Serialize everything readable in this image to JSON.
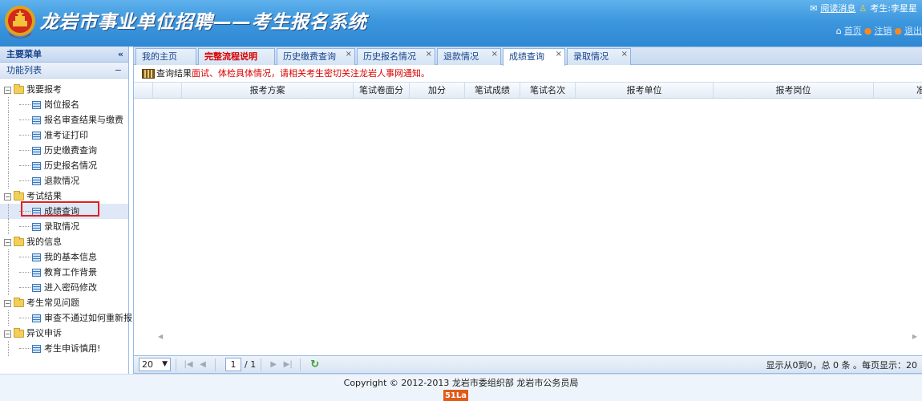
{
  "header": {
    "title": "龙岩市事业单位招聘——考生报名系统",
    "read_msg": "阅读消息",
    "user_label": "考生:李星星",
    "nav_home": "首页",
    "nav_cancel": "注销",
    "nav_exit": "退出"
  },
  "sidebar": {
    "main_menu": "主要菜单",
    "collapse": "«",
    "func_list": "功能列表",
    "minus": "−",
    "groups": [
      {
        "label": "我要报考",
        "items": [
          "岗位报名",
          "报名审查结果与缴费",
          "准考证打印",
          "历史缴费查询",
          "历史报名情况",
          "退款情况"
        ]
      },
      {
        "label": "考试结果",
        "items": [
          "成绩查询",
          "录取情况"
        ]
      },
      {
        "label": "我的信息",
        "items": [
          "我的基本信息",
          "教育工作背景",
          "进入密码修改"
        ]
      },
      {
        "label": "考生常见问题",
        "items": [
          "审查不通过如何重新报"
        ]
      },
      {
        "label": "异议申诉",
        "items": [
          "考生申诉慎用!"
        ]
      }
    ]
  },
  "tabs": [
    {
      "label": "我的主页"
    },
    {
      "label": "完整流程说明"
    },
    {
      "label": "历史缴费查询"
    },
    {
      "label": "历史报名情况"
    },
    {
      "label": "退款情况"
    },
    {
      "label": "成绩查询"
    },
    {
      "label": "录取情况"
    }
  ],
  "tab_close": "×",
  "notice": {
    "prefix": "查询结果",
    "text": "面试、体检具体情况，请相关考生密切关注龙岩人事网通知。"
  },
  "grid": {
    "columns": [
      "",
      "",
      "报考方案",
      "笔试卷面分",
      "加分",
      "笔试成绩",
      "笔试名次",
      "报考单位",
      "报考岗位",
      "准考证号"
    ]
  },
  "pager": {
    "page_size": "20",
    "page": "1",
    "total": "/ 1",
    "info": "显示从0到0，总 0 条 。每页显示：20"
  },
  "footer": {
    "copyright": "Copyright © 2012-2013 龙岩市委组织部 龙岩市公务员局",
    "badge": "51La"
  }
}
